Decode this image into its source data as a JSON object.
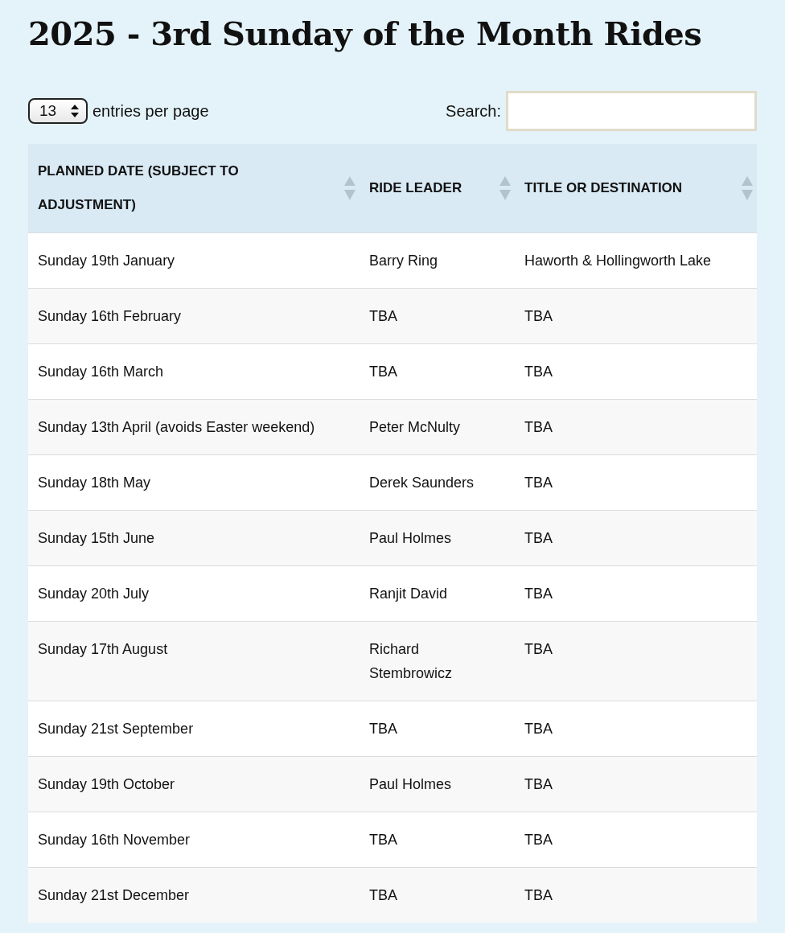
{
  "title": "2025 - 3rd Sunday of the Month Rides",
  "length_menu": {
    "value": "13",
    "label": "entries per page"
  },
  "search": {
    "label": "Search:"
  },
  "table": {
    "columns": [
      "PLANNED DATE (SUBJECT TO ADJUSTMENT)",
      "RIDE LEADER",
      "TITLE OR DESTINATION"
    ],
    "rows": [
      [
        "Sunday 19th January",
        "Barry Ring",
        "Haworth & Hollingworth Lake"
      ],
      [
        "Sunday 16th February",
        "TBA",
        "TBA"
      ],
      [
        "Sunday 16th March",
        "TBA",
        "TBA"
      ],
      [
        "Sunday 13th April (avoids Easter weekend)",
        "Peter McNulty",
        "TBA"
      ],
      [
        "Sunday 18th May",
        "Derek Saunders",
        "TBA"
      ],
      [
        "Sunday 15th June",
        "Paul Holmes",
        "TBA"
      ],
      [
        "Sunday 20th July",
        "Ranjit David",
        "TBA"
      ],
      [
        "Sunday 17th August",
        "Richard Stembrowicz",
        "TBA"
      ],
      [
        "Sunday 21st September",
        "TBA",
        "TBA"
      ],
      [
        "Sunday 19th October",
        "Paul Holmes",
        "TBA"
      ],
      [
        "Sunday 16th November",
        "TBA",
        "TBA"
      ],
      [
        "Sunday 21st December",
        "TBA",
        "TBA"
      ]
    ]
  }
}
